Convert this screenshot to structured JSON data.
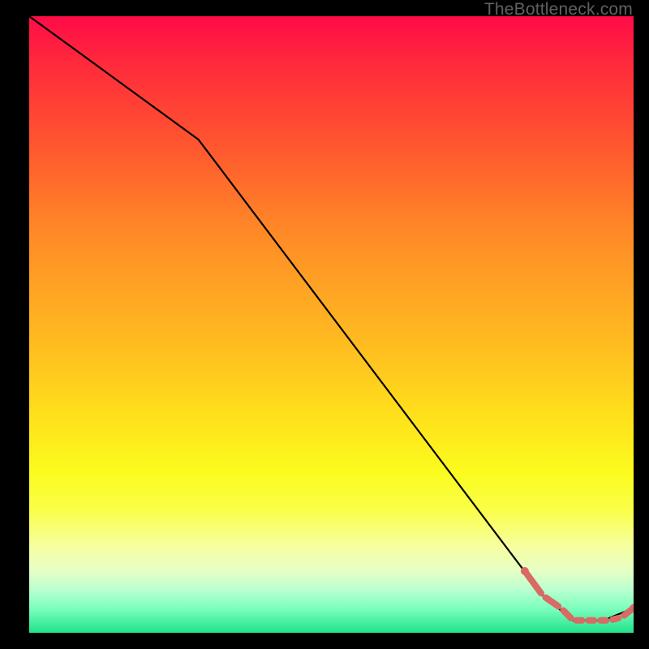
{
  "watermark": "TheBottleneck.com",
  "chart_data": {
    "type": "line",
    "title": "",
    "xlabel": "",
    "ylabel": "",
    "xlim": [
      0,
      100
    ],
    "ylim": [
      0,
      100
    ],
    "grid": false,
    "series": [
      {
        "name": "curve",
        "style": "solid-black",
        "x": [
          0,
          28,
          85,
          90,
          95,
          100
        ],
        "y": [
          100,
          80,
          6,
          2,
          2,
          4
        ]
      },
      {
        "name": "flat-highlight",
        "style": "dashed-salmon",
        "x": [
          82,
          85,
          88,
          90,
          92,
          94,
          96,
          98,
          100
        ],
        "y": [
          10,
          6,
          4,
          2,
          2,
          2,
          2,
          2.5,
          4
        ]
      }
    ],
    "colors": {
      "curve": "#000000",
      "highlight": "#d96a64",
      "gradient_top": "#ff0b47",
      "gradient_mid": "#ffe41b",
      "gradient_bottom": "#20e38a"
    }
  }
}
